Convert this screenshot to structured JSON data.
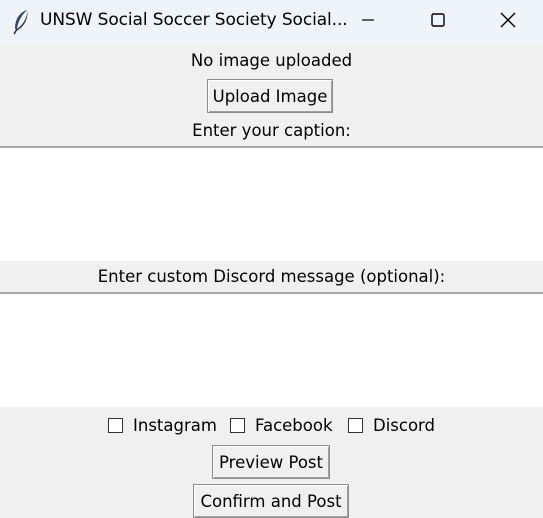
{
  "window": {
    "title": "UNSW Social Soccer Society Social...",
    "icon": "feather-icon",
    "controls": [
      "minimize-icon",
      "maximize-icon",
      "close-icon"
    ]
  },
  "image_section": {
    "status_text": "No image uploaded",
    "upload_button_label": "Upload Image"
  },
  "caption_section": {
    "label": "Enter your caption:",
    "value": ""
  },
  "discord_section": {
    "label": "Enter custom Discord message (optional):",
    "value": ""
  },
  "platforms": [
    {
      "label": "Instagram",
      "checked": false
    },
    {
      "label": "Facebook",
      "checked": false
    },
    {
      "label": "Discord",
      "checked": false
    }
  ],
  "actions": {
    "preview_label": "Preview Post",
    "confirm_label": "Confirm and Post"
  }
}
